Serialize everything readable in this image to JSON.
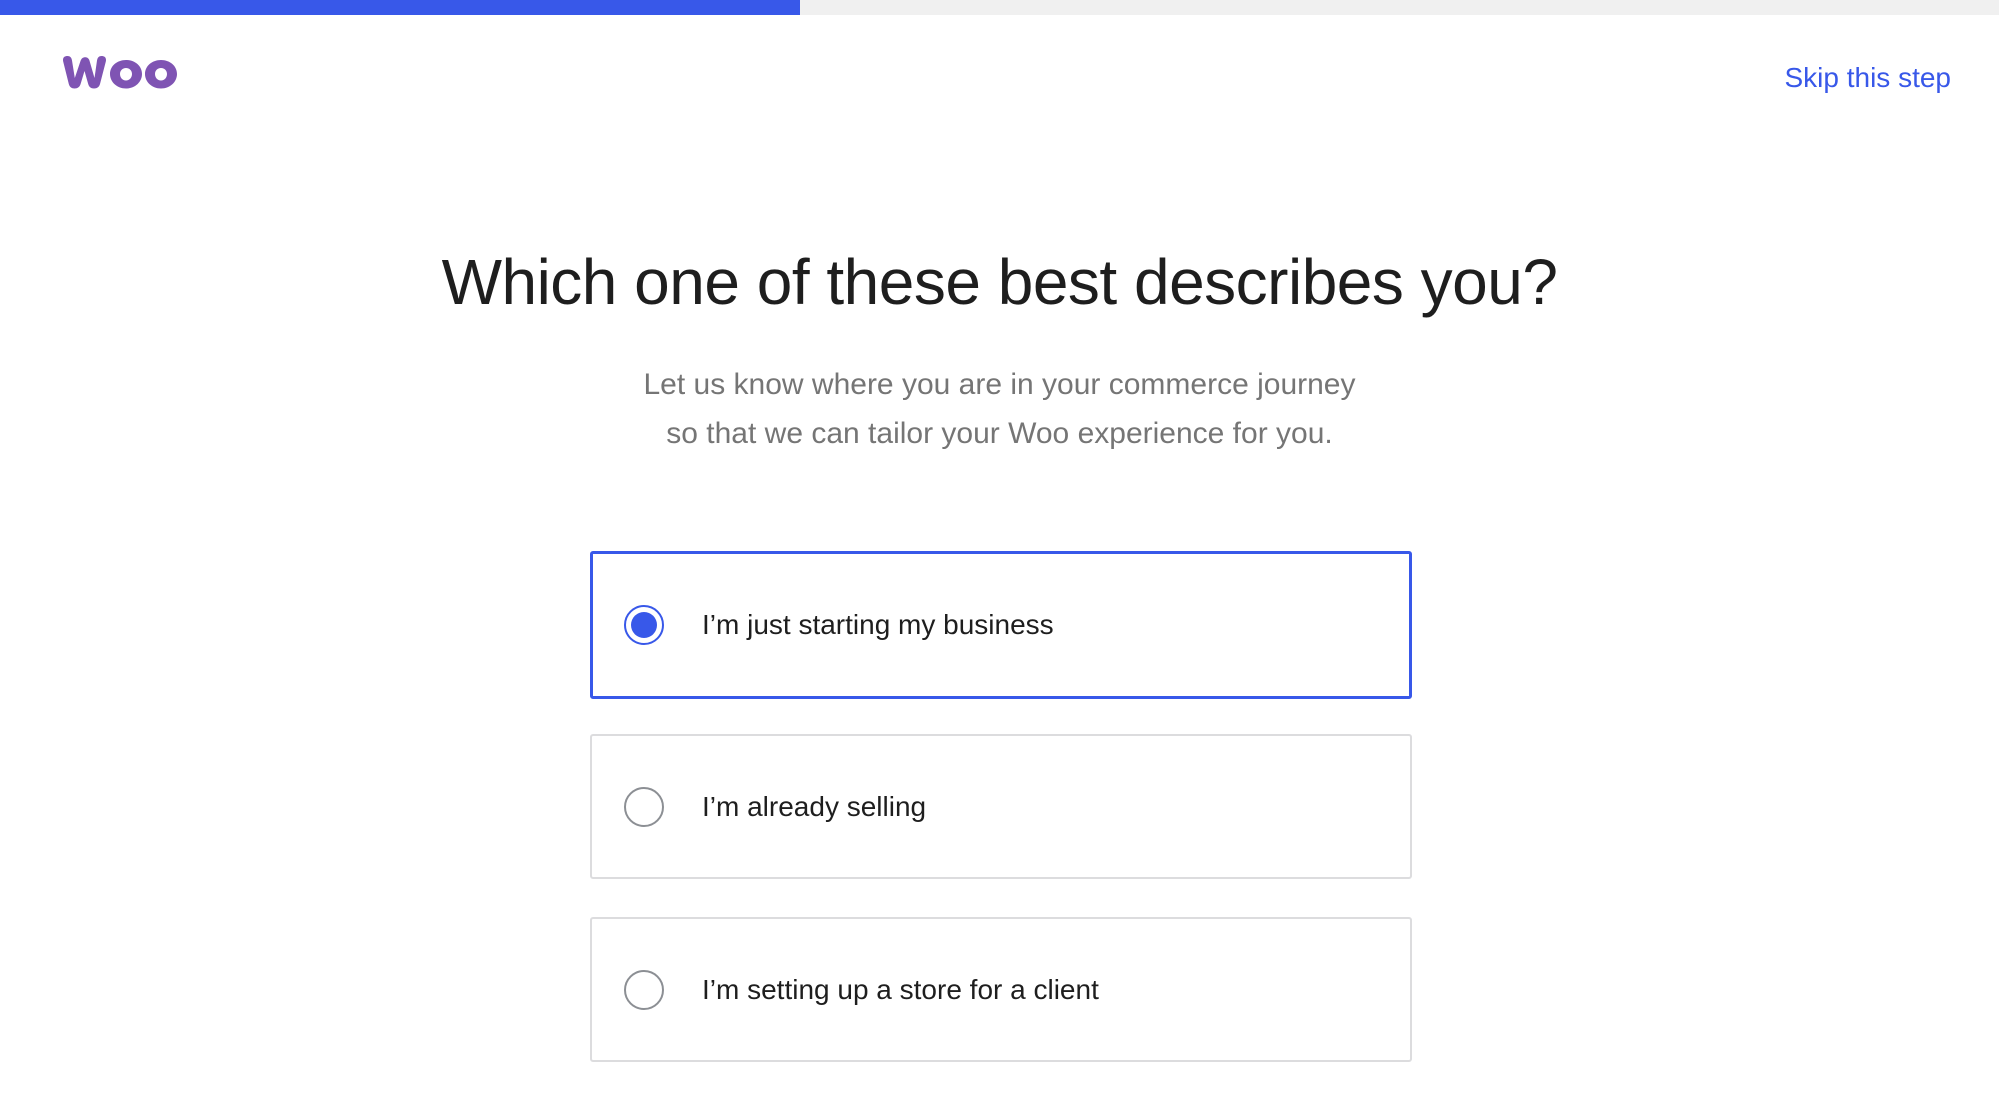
{
  "progress": {
    "percent": 40,
    "color": "#3858e9"
  },
  "header": {
    "logo_text": "woo",
    "logo_color": "#7f54b3",
    "skip_label": "Skip this step"
  },
  "main": {
    "title": "Which one of these best describes you?",
    "subtitle_line1": "Let us know where you are in your commerce journey",
    "subtitle_line2": "so that we can tailor your Woo experience for you."
  },
  "options": [
    {
      "label": "I’m just starting my business",
      "selected": true
    },
    {
      "label": "I’m already selling",
      "selected": false
    },
    {
      "label": "I’m setting up a store for a client",
      "selected": false
    }
  ]
}
